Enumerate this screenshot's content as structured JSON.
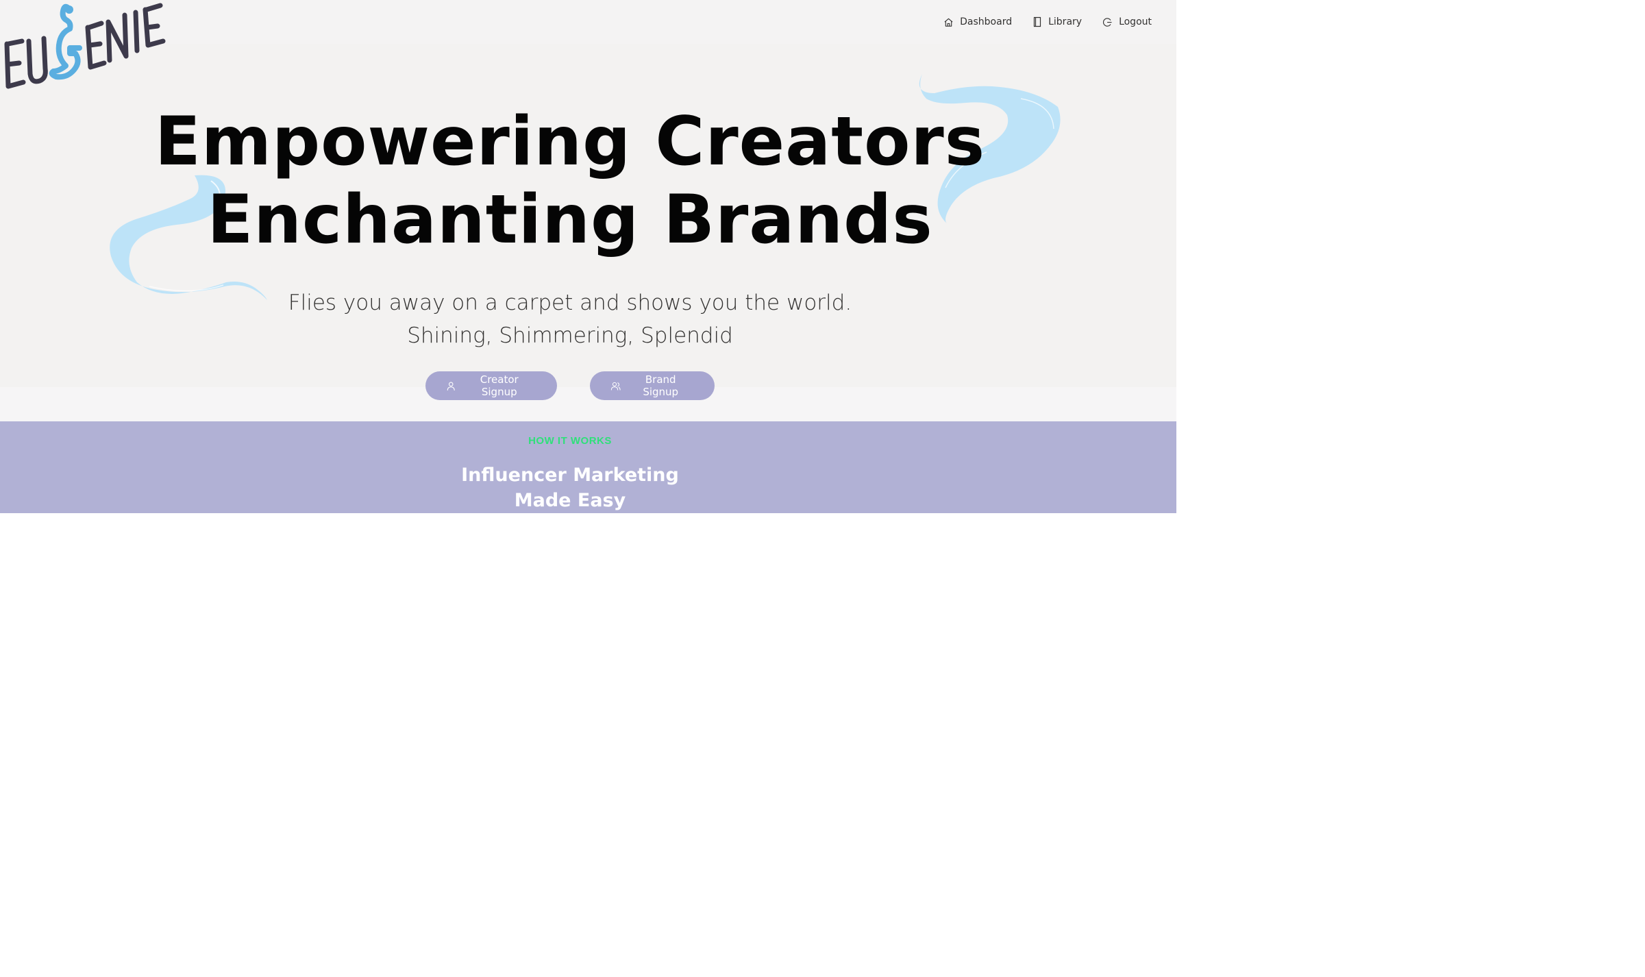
{
  "brand": {
    "logo_text": "EUGENIE",
    "logo_color": "#3d3a4b",
    "genie_color": "#5aaee0"
  },
  "nav": {
    "items": [
      {
        "label": "Dashboard",
        "icon": "home-icon"
      },
      {
        "label": "Library",
        "icon": "book-icon"
      },
      {
        "label": "Logout",
        "icon": "logout-icon"
      }
    ]
  },
  "hero": {
    "headline_line1": "Empowering Creators",
    "headline_line2": "Enchanting Brands",
    "subline_line1": "Flies you away on a carpet and shows you the world.",
    "subline_line2": "Shining, Shimmering, Splendid",
    "swirl_color": "#bde3f8",
    "buttons": [
      {
        "label": "Creator Signup",
        "icon": "person-icon"
      },
      {
        "label": "Brand Signup",
        "icon": "people-icon"
      }
    ],
    "button_color": "#a7a6d0"
  },
  "how_it_works": {
    "eyebrow": "HOW IT WORKS",
    "title_line1": "Influencer Marketing",
    "title_line2": "Made Easy",
    "background": "#b1b1d5",
    "eyebrow_color": "#2fe07a"
  }
}
